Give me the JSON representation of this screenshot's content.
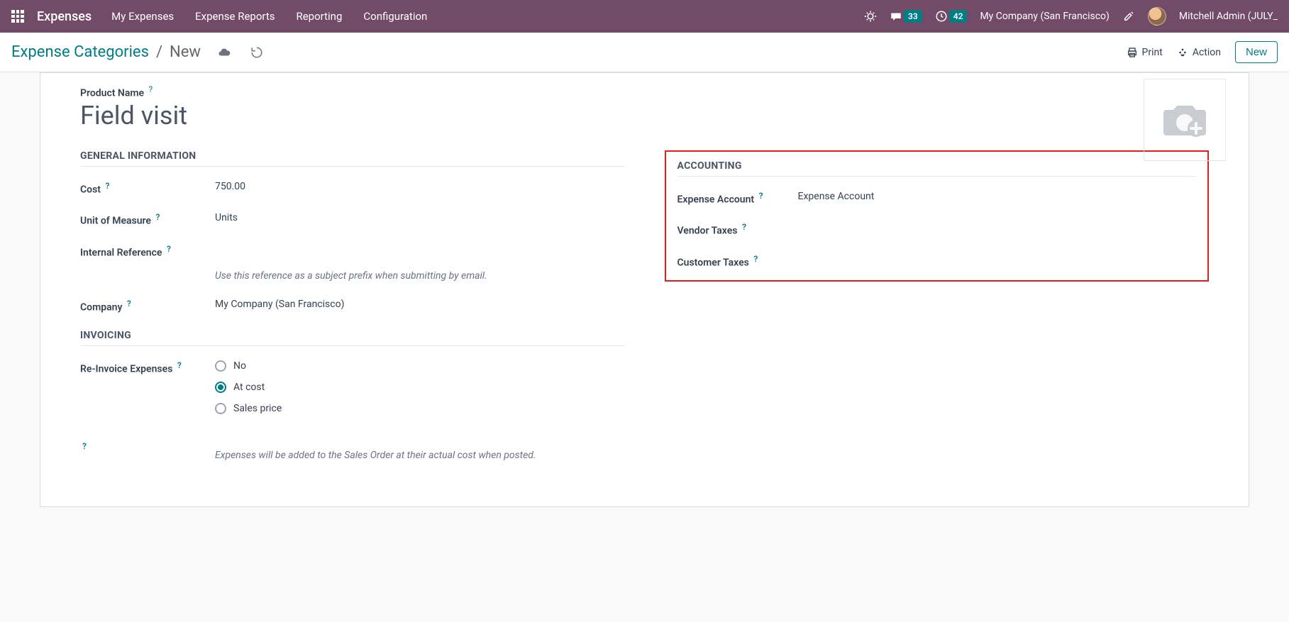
{
  "topbar": {
    "brand": "Expenses",
    "menu": [
      "My Expenses",
      "Expense Reports",
      "Reporting",
      "Configuration"
    ],
    "messages_count": "33",
    "activities_count": "42",
    "company": "My Company (San Francisco)",
    "user": "Mitchell Admin (JULY_"
  },
  "toolbar": {
    "crumb_root": "Expense Categories",
    "crumb_current": "New",
    "print": "Print",
    "action": "Action",
    "new": "New"
  },
  "form": {
    "product_name_label": "Product Name",
    "product_name": "Field visit",
    "sections": {
      "general": {
        "title": "General Information",
        "cost_label": "Cost",
        "cost_value": "750.00",
        "uom_label": "Unit of Measure",
        "uom_value": "Units",
        "internal_ref_label": "Internal Reference",
        "internal_ref_value": "",
        "internal_ref_hint": "Use this reference as a subject prefix when submitting by email.",
        "company_label": "Company",
        "company_value": "My Company (San Francisco)"
      },
      "accounting": {
        "title": "Accounting",
        "expense_account_label": "Expense Account",
        "expense_account_value": "Expense Account",
        "vendor_taxes_label": "Vendor Taxes",
        "customer_taxes_label": "Customer Taxes"
      },
      "invoicing": {
        "title": "Invoicing",
        "reinvoice_label": "Re-Invoice Expenses",
        "options": [
          "No",
          "At cost",
          "Sales price"
        ],
        "selected": "At cost",
        "hint": "Expenses will be added to the Sales Order at their actual cost when posted."
      }
    }
  },
  "help_mark": "?"
}
